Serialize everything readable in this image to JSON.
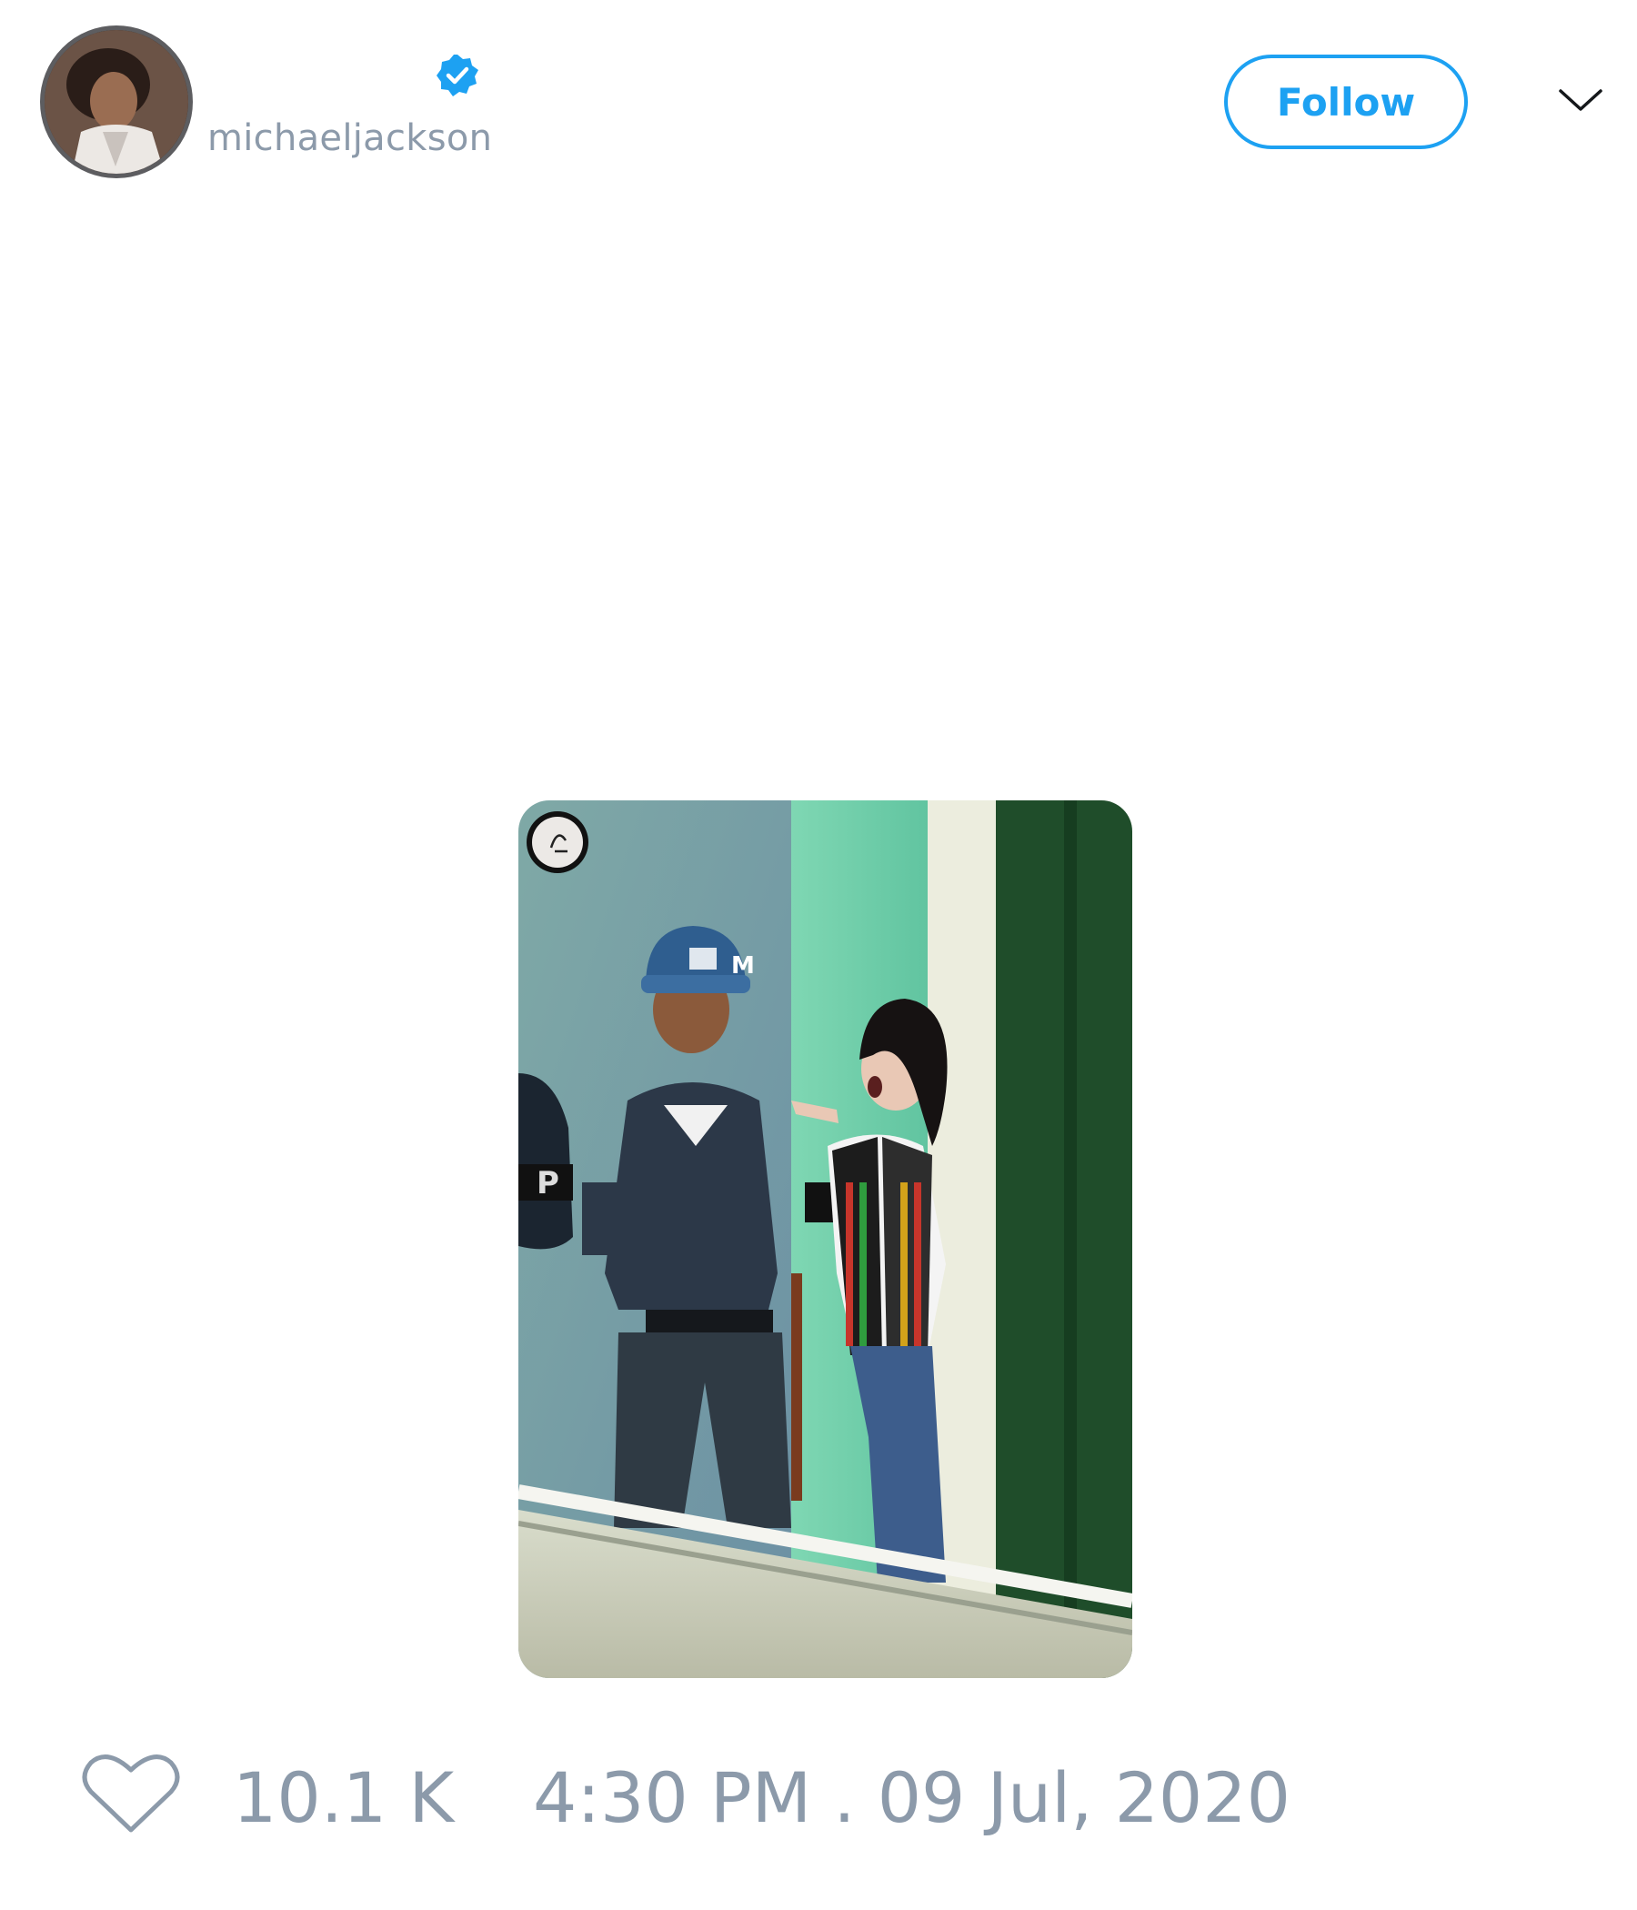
{
  "header": {
    "handle": "michaeljackson",
    "follow_label": "Follow",
    "verified": true
  },
  "colors": {
    "accent": "#1da1f2",
    "muted_text": "#8c9aaa"
  },
  "icons": {
    "verified": "verified-badge-icon",
    "menu": "chevron-down-icon",
    "like": "heart-outline-icon"
  },
  "footer": {
    "likes": "10.1 K",
    "timestamp": "4:30 PM . 09 Jul, 2020"
  }
}
